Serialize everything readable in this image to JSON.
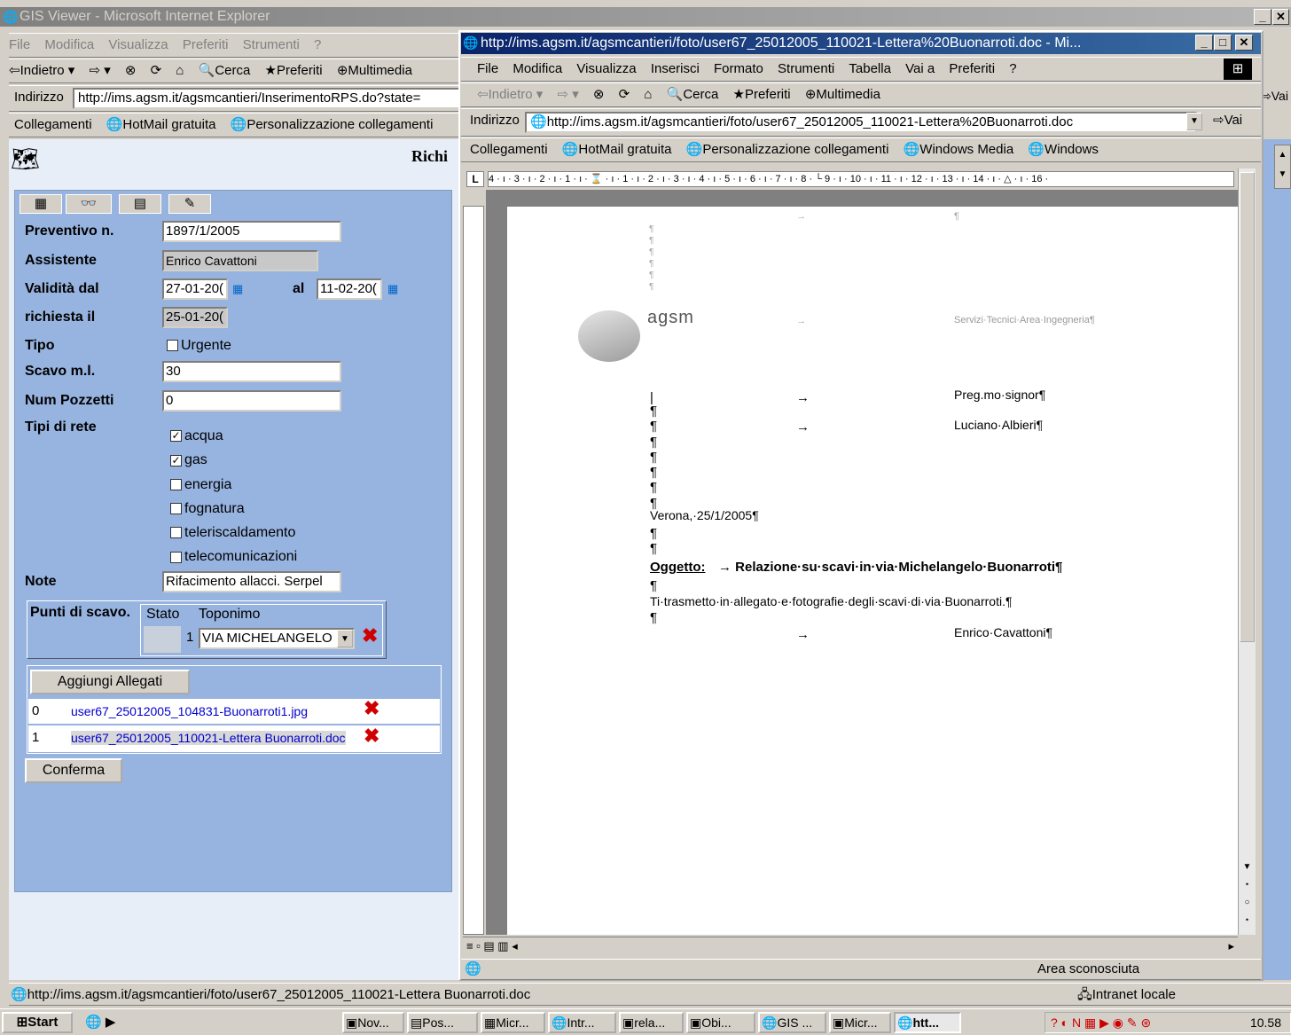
{
  "ie_main": {
    "title": "GIS Viewer - Microsoft Internet Explorer",
    "menu": [
      "File",
      "Modifica",
      "Visualizza",
      "Preferiti",
      "Strumenti",
      "?"
    ],
    "toolbar": [
      "⇦Indietro ▾",
      "⇨ ▾",
      "⊗",
      "⟳",
      "⌂",
      "🔍Cerca",
      "★Preferiti",
      "⊕Multimedia"
    ],
    "address_label": "Indirizzo",
    "address": "http://ims.agsm.it/agsmcantieri/InserimentoRPS.do?state=",
    "links_label": "Collegamenti",
    "links": [
      "HotMail gratuita",
      "Personalizzazione collegamenti"
    ],
    "status": "http://ims.agsm.it/agsmcantieri/foto/user67_25012005_110021-Lettera Buonarroti.doc",
    "zone": "Intranet locale",
    "vai": "Vai"
  },
  "form": {
    "heading": "Richi",
    "tabs": [
      "▦",
      "👓",
      "▤",
      "✎"
    ],
    "preventivo_label": "Preventivo n.",
    "preventivo": "1897/1/2005",
    "assistente_label": "Assistente",
    "assistente": "Enrico Cavattoni",
    "validita_label": "Validità dal",
    "validita_dal": "27-01-20(",
    "al_label": "al",
    "validita_al": "11-02-20(",
    "richiesta_label": "richiesta il",
    "richiesta": "25-01-20(",
    "tipo_label": "Tipo",
    "urgente": "Urgente",
    "scavo_label": "Scavo m.l.",
    "scavo": "30",
    "pozzetti_label": "Num Pozzetti",
    "pozzetti": "0",
    "reti_label": "Tipi di rete",
    "reti": [
      {
        "label": "acqua",
        "checked": true
      },
      {
        "label": "gas",
        "checked": true
      },
      {
        "label": "energia",
        "checked": false
      },
      {
        "label": "fognatura",
        "checked": false
      },
      {
        "label": "teleriscaldamento",
        "checked": false
      },
      {
        "label": "telecomunicazioni",
        "checked": false
      }
    ],
    "note_label": "Note",
    "note": "Rifacimento allacci. Serpel",
    "punti_label": "Punti di scavo.",
    "stato_label": "Stato",
    "toponimo_label": "Toponimo",
    "punto_num": "1",
    "punto_toponimo": "VIA MICHELANGELO",
    "aggiungi": "Aggiungi Allegati",
    "allegati": [
      {
        "n": "0",
        "file": "user67_25012005_104831-Buonarroti1.jpg"
      },
      {
        "n": "1",
        "file": "user67_25012005_110021-Lettera Buonarroti.doc"
      }
    ],
    "conferma": "Conferma"
  },
  "word": {
    "title": "http://ims.agsm.it/agsmcantieri/foto/user67_25012005_110021-Lettera%20Buonarroti.doc - Mi...",
    "menu": [
      "File",
      "Modifica",
      "Visualizza",
      "Inserisci",
      "Formato",
      "Strumenti",
      "Tabella",
      "Vai a",
      "Preferiti",
      "?"
    ],
    "toolbar": [
      "⇦Indietro ▾",
      "⇨ ▾",
      "⊗",
      "⟳",
      "⌂",
      "🔍Cerca",
      "★Preferiti",
      "⊕Multimedia"
    ],
    "address_label": "Indirizzo",
    "address": "http://ims.agsm.it/agsmcantieri/foto/user67_25012005_110021-Lettera%20Buonarroti.doc",
    "vai": "Vai",
    "links_label": "Collegamenti",
    "links": [
      "HotMail gratuita",
      "Personalizzazione collegamenti",
      "Windows Media",
      "Windows"
    ],
    "ruler": "4 · ı · 3 · ı · 2 · ı · 1 · ı · ⌛ · ı · 1 · ı · 2 · ı · 3 · ı · 4 · ı · 5 · ı · 6 · ı · 7 · ı · 8 · └ 9 · ı · 10 · ı · 11 · ı · 12 · ı · 13 · ı · 14 · ı · △ · ı · 16 ·",
    "status": "Area sconosciuta"
  },
  "letter": {
    "logo": "agsm",
    "servizi": "Servizi·Tecnici·Area·Ingegneria¶",
    "preg": "Preg.mo·signor¶",
    "nome": "Luciano·Albieri¶",
    "data": "Verona,·25/1/2005¶",
    "oggetto_label": "Oggetto:",
    "oggetto": "→  Relazione·su·scavi·in·via·Michelangelo·Buonarroti¶",
    "corpo": "Ti·trasmetto·in·allegato·e·fotografie·degli·scavi·di·via·Buonarroti.¶",
    "firma": "Enrico·Cavattoni¶",
    "pil": "¶",
    "arrow": "→"
  },
  "taskbar": {
    "start": "Start",
    "items": [
      "Nov...",
      "Pos...",
      "Micr...",
      "Intr...",
      "rela...",
      "Obi...",
      "GIS ...",
      "Micr...",
      "htt..."
    ],
    "clock": "10.58"
  },
  "colors": {
    "title_active": "#0a246a",
    "form_bg": "#97b3df",
    "link": "#0000cc"
  }
}
